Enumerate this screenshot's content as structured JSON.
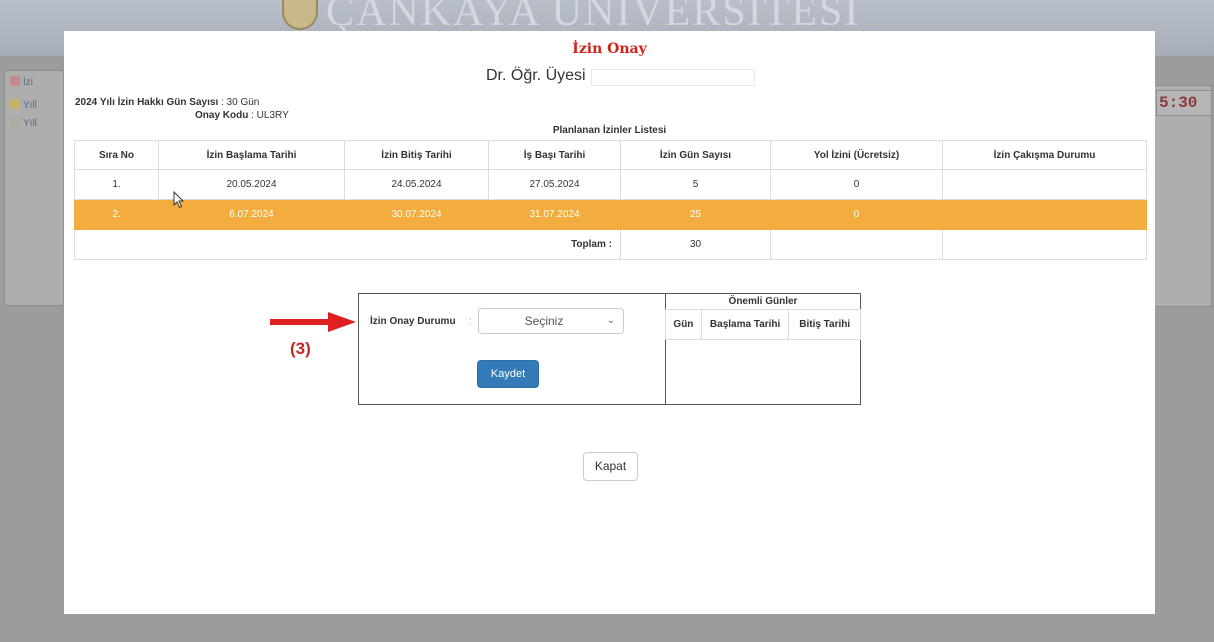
{
  "background": {
    "brand": "ÇANKAYA ÜNİVERSİTESİ",
    "menu_items": [
      "İzi",
      "Yıll",
      "Yıll"
    ],
    "clock": "5:30"
  },
  "modal": {
    "title": "İzin Onay",
    "person_title": "Dr. Öğr. Üyesi",
    "entitlement_label": "2024 Yılı İzin Hakkı Gün Sayısı",
    "entitlement_value": ": 30 Gün",
    "approval_code_label": "Onay Kodu",
    "approval_code_value": ": UL3RY",
    "list_title": "Planlanan İzinler Listesi"
  },
  "table": {
    "headers": [
      "Sıra No",
      "İzin Başlama Tarihi",
      "İzin Bitiş Tarihi",
      "İş Başı Tarihi",
      "İzin Gün Sayısı",
      "Yol İzini (Ücretsiz)",
      "İzin Çakışma Durumu"
    ],
    "rows": [
      {
        "no": "1.",
        "start": "20.05.2024",
        "end": "24.05.2024",
        "return": "27.05.2024",
        "days": "5",
        "travel": "0",
        "conflict": ""
      },
      {
        "no": "2.",
        "start": "6.07.2024",
        "end": "30.07.2024",
        "return": "31.07.2024",
        "days": "25",
        "travel": "0",
        "conflict": ""
      }
    ],
    "total_label": "Toplam :",
    "total_value": "30"
  },
  "form": {
    "status_label": "İzin Onay Durumu",
    "colon": ":",
    "select_value": "Seçiniz",
    "save_label": "Kaydet"
  },
  "important_days": {
    "title": "Önemli Günler",
    "headers": [
      "Gün",
      "Başlama Tarihi",
      "Bitiş Tarihi"
    ]
  },
  "annotation": "(3)",
  "close_label": "Kapat",
  "colors": {
    "title_red": "#d2221c",
    "highlight_row": "#f2ad3e",
    "primary_button": "#337ab7",
    "annotation_red": "#c62828"
  }
}
